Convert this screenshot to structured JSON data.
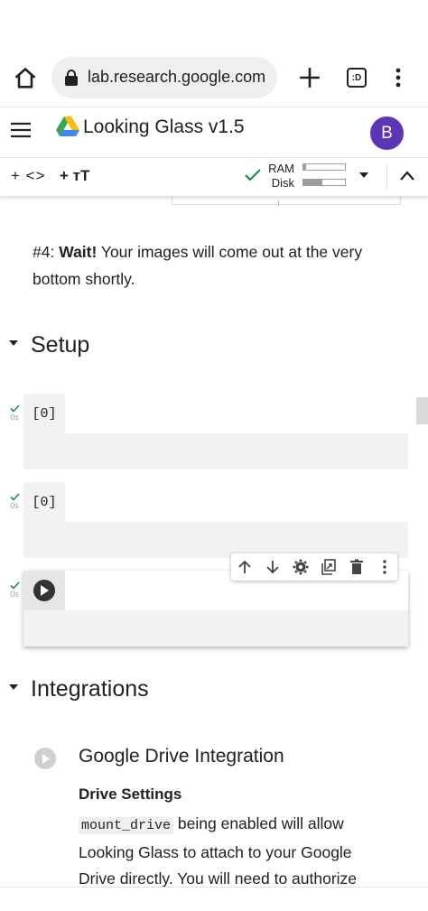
{
  "browser": {
    "url": "lab.research.google.com",
    "tabs_label": ":D"
  },
  "header": {
    "title": "Looking Glass v1.5",
    "avatar_letter": "B",
    "avatar_color": "#5c35b6"
  },
  "toolbar": {
    "add_code_label": "+ <>",
    "add_text_label": "+ тT",
    "ram_label": "RAM",
    "disk_label": "Disk",
    "ram_usage": 0.06,
    "disk_usage": 0.45
  },
  "notebook": {
    "step_number": "#4:",
    "step_bold": "Wait!",
    "step_text": "Your images will come out at the very bottom shortly.",
    "section_setup": "Setup",
    "cells": [
      {
        "prompt": "[0]",
        "time": "0s"
      },
      {
        "prompt": "[0]",
        "time": "0s"
      },
      {
        "prompt": "",
        "time": "0s"
      }
    ],
    "section_integrations": "Integrations",
    "drive_title": "Google Drive Integration",
    "drive_subtitle": "Drive Settings",
    "drive_code": "mount_drive",
    "drive_body": "being enabled will allow Looking Glass to attach to your Google Drive directly. You will need to authorize"
  }
}
